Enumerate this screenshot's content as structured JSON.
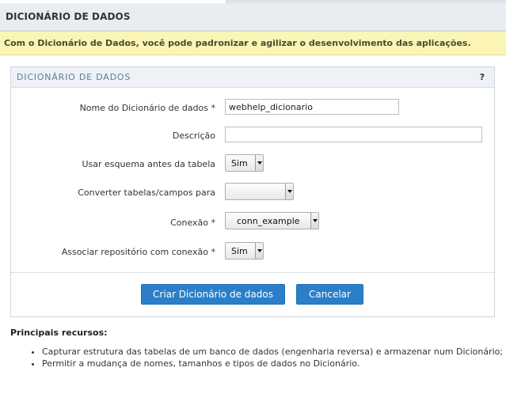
{
  "header": {
    "title": "DICIONÁRIO DE DADOS"
  },
  "notice": {
    "text": "Com o Dicionário de Dados, você pode padronizar e agilizar o desenvolvimento das aplicações."
  },
  "panel": {
    "title": "DICIONÁRIO DE DADOS",
    "help_label": "?",
    "fields": {
      "name": {
        "label": "Nome do Dicionário de dados *",
        "value": "webhelp_dicionario"
      },
      "description": {
        "label": "Descrição",
        "value": ""
      },
      "use_schema": {
        "label": "Usar esquema antes da tabela",
        "value": "Sim"
      },
      "convert": {
        "label": "Converter tabelas/campos para",
        "value": ""
      },
      "connection": {
        "label": "Conexão *",
        "value": "conn_example"
      },
      "associate_repo": {
        "label": "Associar repositório com conexão *",
        "value": "Sim"
      }
    },
    "buttons": {
      "create": "Criar Dicionário de dados",
      "cancel": "Cancelar"
    }
  },
  "features": {
    "title": "Principais recursos:",
    "items": [
      "Capturar estrutura das tabelas de um banco de dados (engenharia reversa) e armazenar num Dicionário;",
      "Permitir a mudança de nomes, tamanhos e tipos de dados no Dicionário."
    ]
  },
  "colors": {
    "button_primary": "#2a7fc8",
    "notice_bg": "#fbf6b5",
    "header_bg": "#e9edf2",
    "panel_title": "#5d7b97"
  }
}
